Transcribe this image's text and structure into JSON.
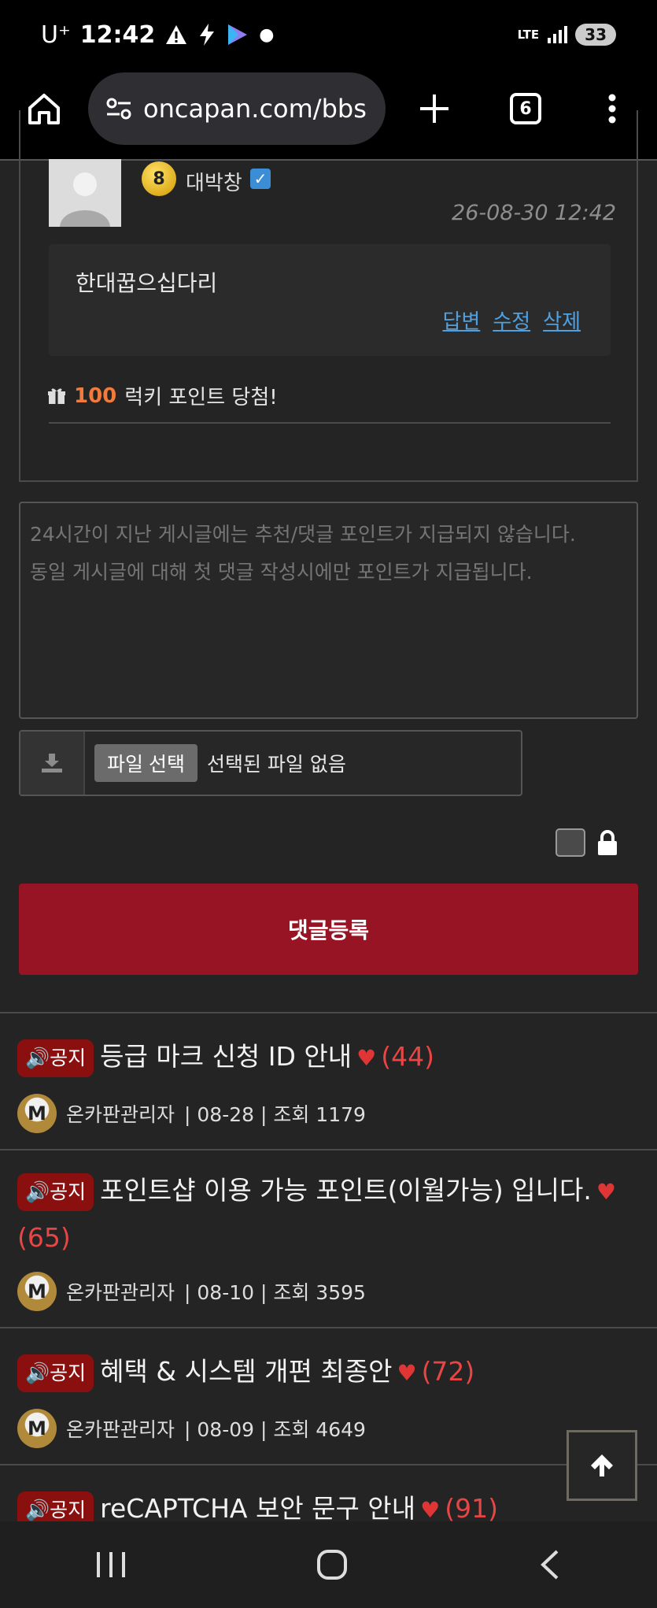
{
  "status_bar": {
    "carrier": "U⁺",
    "time": "12:42",
    "network": "LTE",
    "battery": "33"
  },
  "browser": {
    "url": "oncapan.com/bbs",
    "tab_count": "6"
  },
  "comment": {
    "level": "8",
    "nickname": "대박창",
    "date": "26-08-30 12:42",
    "text": "한대꿉으십다리",
    "actions": {
      "reply": "답변",
      "edit": "수정",
      "delete": "삭제"
    },
    "lucky_points": "100",
    "lucky_text": "럭키 포인트 당첨!"
  },
  "editor": {
    "placeholder": "24시간이 지난 게시글에는 추천/댓글 포인트가 지급되지 않습니다.\n동일 게시글에 대해 첫 댓글 작성시에만 포인트가 지급됩니다.",
    "file_button": "파일 선택",
    "file_status": "선택된 파일 없음",
    "submit_label": "댓글등록"
  },
  "notices": [
    {
      "badge": "공지",
      "title": "등급 마크 신청 ID 안내",
      "count": "(44)",
      "author": "온카판관리자",
      "meta": "| 08-28 | 조회 1179"
    },
    {
      "badge": "공지",
      "title": "포인트샵 이용 가능 포인트(이월가능) 입니다.",
      "count": "(65)",
      "author": "온카판관리자",
      "meta": "| 08-10 | 조회 3595"
    },
    {
      "badge": "공지",
      "title": "혜택 & 시스템 개편 최종안",
      "count": "(72)",
      "author": "온카판관리자",
      "meta": "| 08-09 | 조회 4649"
    },
    {
      "badge": "공지",
      "title": "reCAPTCHA 보안 문구 안내",
      "count": "(91)"
    }
  ],
  "icons": {
    "home": "home-icon",
    "site_settings": "site-settings-icon",
    "new_tab": "plus-icon",
    "menu": "more-vert-icon",
    "gift": "gift-icon",
    "download": "download-icon",
    "lock": "lock-icon",
    "speaker": "speaker-icon",
    "heart": "heart-icon",
    "arrow_up": "arrow-up-icon"
  },
  "colors": {
    "submit_bg": "#961423",
    "notice_badge": "#8a1010",
    "heart": "#e03535",
    "link": "#4ea0e0",
    "lucky_points": "#f07b3a"
  }
}
